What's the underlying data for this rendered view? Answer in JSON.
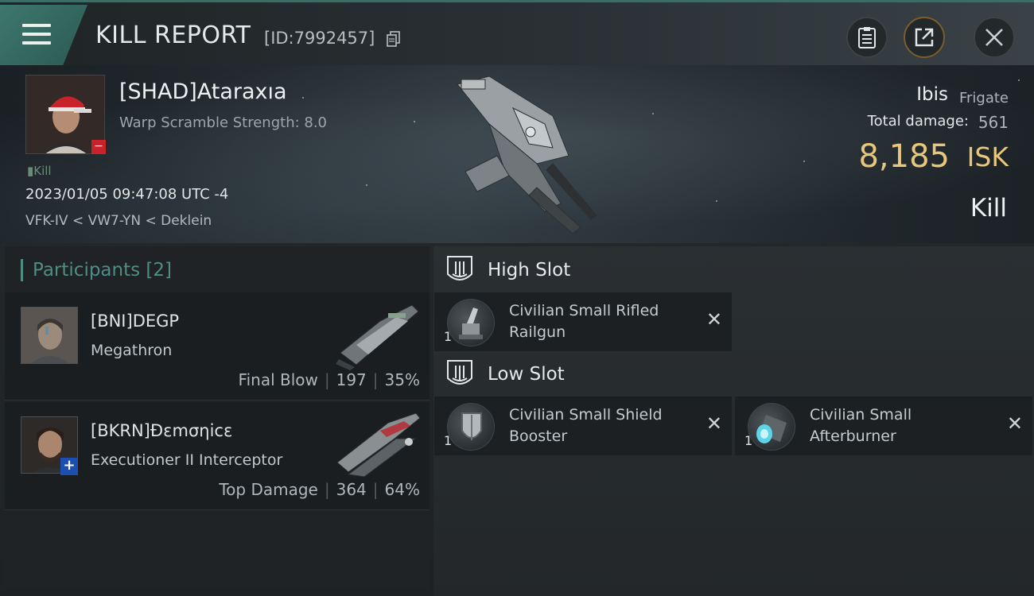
{
  "header": {
    "title": "KILL REPORT",
    "report_id": "[ID:7992457]"
  },
  "victim": {
    "name": "[SHAD]Ataraxıa",
    "warp_scramble": "Warp Scramble Strength: 8.0",
    "tag": "Kill",
    "datetime": "2023/01/05 09:47:08 UTC -4",
    "location": "VFK-IV < VW7-YN < Deklein"
  },
  "ship": {
    "name": "Ibis",
    "class": "Frigate",
    "total_damage_label": "Total damage:",
    "total_damage": "561",
    "isk_value": "8,185",
    "isk_unit": "ISK",
    "result": "Kill"
  },
  "participants": {
    "title": "Participants [2]",
    "items": [
      {
        "name": "[BNI]DEGP",
        "ship": "Megathron",
        "role": "Final Blow",
        "damage": "197",
        "percent": "35%"
      },
      {
        "name": "[BKRN]Đεmσηicε",
        "ship": "Executioner II Interceptor",
        "role": "Top Damage",
        "damage": "364",
        "percent": "64%"
      }
    ]
  },
  "slots": {
    "high": {
      "title": "High Slot",
      "modules": [
        {
          "qty": "1",
          "name": "Civilian Small Rifled Railgun",
          "icon": "railgun-icon"
        }
      ]
    },
    "low": {
      "title": "Low Slot",
      "modules": [
        {
          "qty": "1",
          "name": "Civilian Small Shield Booster",
          "icon": "shield-booster-icon"
        },
        {
          "qty": "1",
          "name": "Civilian Small Afterburner",
          "icon": "afterburner-icon"
        }
      ]
    }
  },
  "colors": {
    "accent_teal": "#4e8e84",
    "isk_gold": "#e7c77a",
    "danger_red": "#c8222a",
    "badge_blue": "#1d4fb0"
  }
}
